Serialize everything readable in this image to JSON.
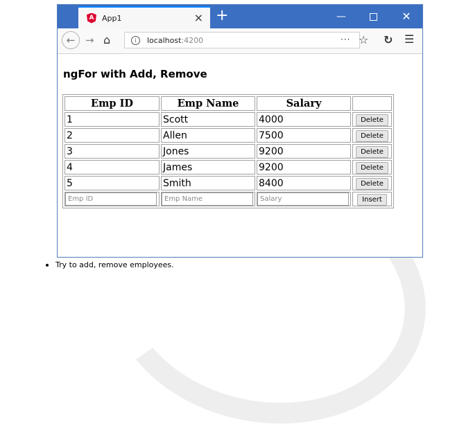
{
  "browser": {
    "tab_title": "App1",
    "tab_close_icon": "close-icon",
    "new_tab_icon": "plus-icon",
    "url_host": "localhost",
    "url_port": ":4200",
    "page_actions": "···"
  },
  "page": {
    "heading": "ngFor with Add, Remove",
    "columns": [
      "Emp ID",
      "Emp Name",
      "Salary",
      ""
    ],
    "rows": [
      {
        "id": "1",
        "name": "Scott",
        "salary": "4000",
        "action": "Delete"
      },
      {
        "id": "2",
        "name": "Allen",
        "salary": "7500",
        "action": "Delete"
      },
      {
        "id": "3",
        "name": "Jones",
        "salary": "9200",
        "action": "Delete"
      },
      {
        "id": "4",
        "name": "James",
        "salary": "9200",
        "action": "Delete"
      },
      {
        "id": "5",
        "name": "Smith",
        "salary": "8400",
        "action": "Delete"
      }
    ],
    "inputs": {
      "id_placeholder": "Emp ID",
      "name_placeholder": "Emp Name",
      "salary_placeholder": "Salary",
      "insert_label": "Insert"
    }
  },
  "note": "Try to add, remove employees.",
  "colors": {
    "titlebar": "#3b6fc2",
    "angular_red": "#dd0031",
    "tab_accent": "#0a84ff"
  }
}
